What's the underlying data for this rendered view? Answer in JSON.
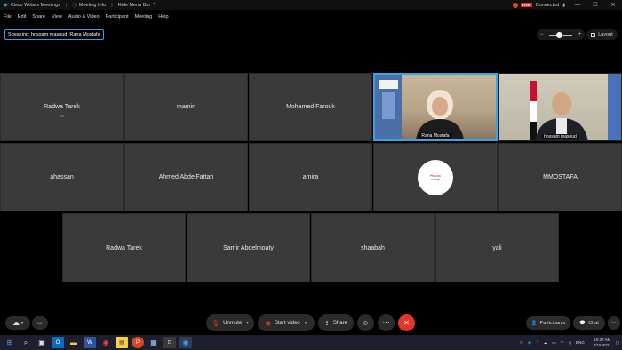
{
  "titlebar": {
    "app_title": "Cisco Webex Meetings",
    "meeting_info": "Meeting Info",
    "hide_menu": "Hide Menu Bar",
    "live_label": "LIVE",
    "status": "Connected"
  },
  "menubar": {
    "items": [
      "File",
      "Edit",
      "Share",
      "View",
      "Audio & Video",
      "Participant",
      "Meeting",
      "Help"
    ]
  },
  "speaking": "Speaking: hossam masoud, Rana Mostafa",
  "layout_label": "Layout",
  "tiles": {
    "radwa_1": {
      "name": "Radwa Tarek",
      "sub": "info"
    },
    "mamin": {
      "name": "mamin"
    },
    "mohamed": {
      "name": "Mohamed Farouk"
    },
    "rana": {
      "name": "Rana Mostafa"
    },
    "hossam": {
      "name": "hossam masoud"
    },
    "ahassan": {
      "name": "ahassan"
    },
    "ahmed": {
      "name": "Ahmed AbdelFattah"
    },
    "amira": {
      "name": "amira"
    },
    "logo_tile": {
      "logo_line1": "Pharos",
      "logo_line2": "College"
    },
    "mmostafa": {
      "name": "MMOSTAFA"
    },
    "radwa_2": {
      "name": "Radwa Tarek"
    },
    "samir": {
      "name": "Samir Abdelmoaty"
    },
    "shaabah": {
      "name": "shaabah"
    },
    "yali": {
      "name": "yali"
    }
  },
  "controls": {
    "unmute": "Unmute",
    "start_video": "Start video",
    "share": "Share",
    "participants": "Participants",
    "chat": "Chat"
  },
  "taskbar": {
    "lang": "ENG",
    "time": "10:37 AM",
    "date": "7/15/2021"
  },
  "colors": {
    "active_border": "#35a7e6",
    "leave_red": "#e2352b",
    "tile_bg": "#3a3a3a"
  }
}
